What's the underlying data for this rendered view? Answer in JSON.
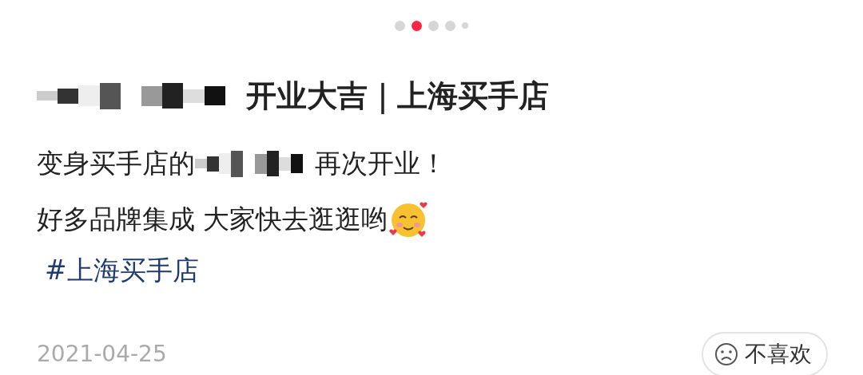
{
  "carousel": {
    "dots": [
      {
        "kind": "full",
        "selected": false
      },
      {
        "kind": "full",
        "selected": true
      },
      {
        "kind": "full",
        "selected": false
      },
      {
        "kind": "full",
        "selected": false
      },
      {
        "kind": "small",
        "selected": false
      }
    ]
  },
  "title": [
    {
      "kind": "redacted"
    },
    {
      "kind": "text",
      "text": "开业大吉｜上海买手店"
    }
  ],
  "body": [
    [
      {
        "kind": "text",
        "text": "变身买手店的"
      },
      {
        "kind": "redacted"
      },
      {
        "kind": "text",
        "text": "再次开业！"
      }
    ],
    [
      {
        "kind": "text",
        "text": "好多品牌集成 大家快去逛逛哟"
      },
      {
        "kind": "emoji"
      }
    ]
  ],
  "hashtag": "#上海买手店",
  "date": "2021-04-25",
  "dislike_button": {
    "label": "不喜欢"
  }
}
